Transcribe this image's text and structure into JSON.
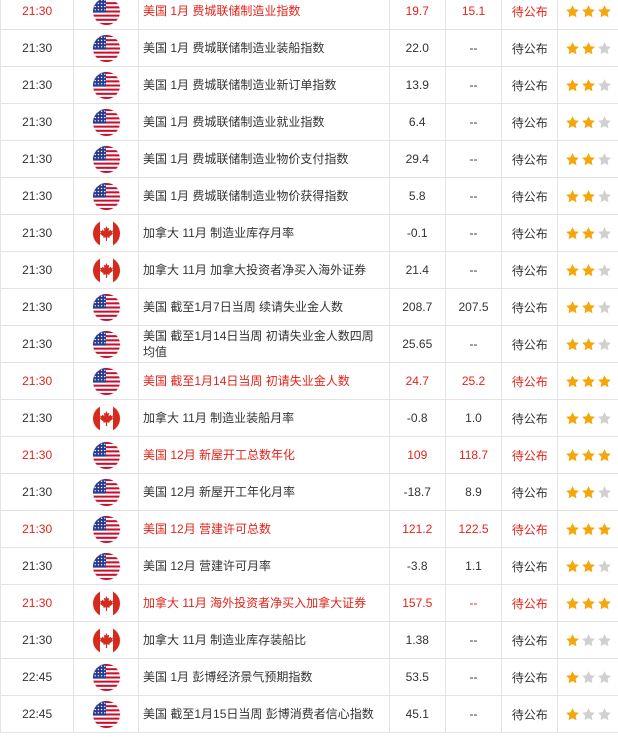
{
  "colors": {
    "highlight": "#e2231a",
    "star_on": "#f5a70a",
    "star_off": "#d0d0d0",
    "border": "#e3e3e3"
  },
  "rows": [
    {
      "time": "21:30",
      "country": "us",
      "event": "美国 1月 费城联储制造业指数",
      "prev": "19.7",
      "pred": "15.1",
      "actual": "待公布",
      "stars": 3,
      "hl": true
    },
    {
      "time": "21:30",
      "country": "us",
      "event": "美国 1月 费城联储制造业装船指数",
      "prev": "22.0",
      "pred": "--",
      "actual": "待公布",
      "stars": 2,
      "hl": false
    },
    {
      "time": "21:30",
      "country": "us",
      "event": "美国 1月 费城联储制造业新订单指数",
      "prev": "13.9",
      "pred": "--",
      "actual": "待公布",
      "stars": 2,
      "hl": false
    },
    {
      "time": "21:30",
      "country": "us",
      "event": "美国 1月 费城联储制造业就业指数",
      "prev": "6.4",
      "pred": "--",
      "actual": "待公布",
      "stars": 2,
      "hl": false
    },
    {
      "time": "21:30",
      "country": "us",
      "event": "美国 1月 费城联储制造业物价支付指数",
      "prev": "29.4",
      "pred": "--",
      "actual": "待公布",
      "stars": 2,
      "hl": false
    },
    {
      "time": "21:30",
      "country": "us",
      "event": "美国 1月 费城联储制造业物价获得指数",
      "prev": "5.8",
      "pred": "--",
      "actual": "待公布",
      "stars": 2,
      "hl": false
    },
    {
      "time": "21:30",
      "country": "ca",
      "event": "加拿大 11月 制造业库存月率",
      "prev": "-0.1",
      "pred": "--",
      "actual": "待公布",
      "stars": 2,
      "hl": false
    },
    {
      "time": "21:30",
      "country": "ca",
      "event": "加拿大 11月 加拿大投资者净买入海外证券",
      "prev": "21.4",
      "pred": "--",
      "actual": "待公布",
      "stars": 2,
      "hl": false
    },
    {
      "time": "21:30",
      "country": "us",
      "event": "美国 截至1月7日当周 续请失业金人数",
      "prev": "208.7",
      "pred": "207.5",
      "actual": "待公布",
      "stars": 2,
      "hl": false
    },
    {
      "time": "21:30",
      "country": "us",
      "event": "美国 截至1月14日当周 初请失业金人数四周均值",
      "prev": "25.65",
      "pred": "--",
      "actual": "待公布",
      "stars": 2,
      "hl": false
    },
    {
      "time": "21:30",
      "country": "us",
      "event": "美国 截至1月14日当周 初请失业金人数",
      "prev": "24.7",
      "pred": "25.2",
      "actual": "待公布",
      "stars": 3,
      "hl": true
    },
    {
      "time": "21:30",
      "country": "ca",
      "event": "加拿大 11月 制造业装船月率",
      "prev": "-0.8",
      "pred": "1.0",
      "actual": "待公布",
      "stars": 2,
      "hl": false
    },
    {
      "time": "21:30",
      "country": "us",
      "event": "美国 12月 新屋开工总数年化",
      "prev": "109",
      "pred": "118.7",
      "actual": "待公布",
      "stars": 3,
      "hl": true
    },
    {
      "time": "21:30",
      "country": "us",
      "event": "美国 12月 新屋开工年化月率",
      "prev": "-18.7",
      "pred": "8.9",
      "actual": "待公布",
      "stars": 2,
      "hl": false
    },
    {
      "time": "21:30",
      "country": "us",
      "event": "美国 12月 营建许可总数",
      "prev": "121.2",
      "pred": "122.5",
      "actual": "待公布",
      "stars": 3,
      "hl": true
    },
    {
      "time": "21:30",
      "country": "us",
      "event": "美国 12月 营建许可月率",
      "prev": "-3.8",
      "pred": "1.1",
      "actual": "待公布",
      "stars": 2,
      "hl": false
    },
    {
      "time": "21:30",
      "country": "ca",
      "event": "加拿大 11月 海外投资者净买入加拿大证券",
      "prev": "157.5",
      "pred": "--",
      "actual": "待公布",
      "stars": 3,
      "hl": true
    },
    {
      "time": "21:30",
      "country": "ca",
      "event": "加拿大 11月 制造业库存装船比",
      "prev": "1.38",
      "pred": "--",
      "actual": "待公布",
      "stars": 1,
      "hl": false
    },
    {
      "time": "22:45",
      "country": "us",
      "event": "美国 1月 彭博经济景气预期指数",
      "prev": "53.5",
      "pred": "--",
      "actual": "待公布",
      "stars": 1,
      "hl": false
    },
    {
      "time": "22:45",
      "country": "us",
      "event": "美国 截至1月15日当周 彭博消费者信心指数",
      "prev": "45.1",
      "pred": "--",
      "actual": "待公布",
      "stars": 1,
      "hl": false
    }
  ]
}
